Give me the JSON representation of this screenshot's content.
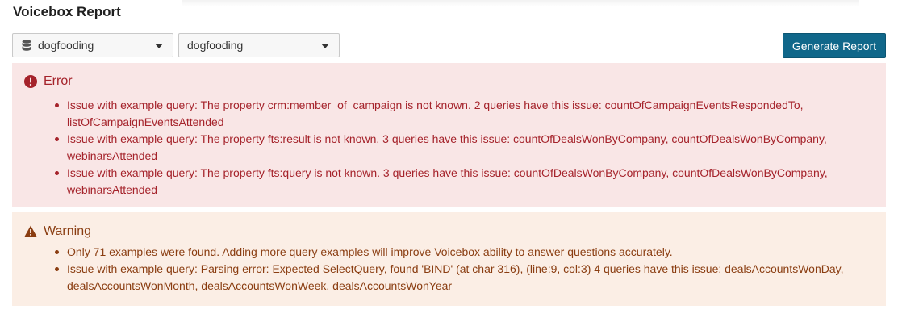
{
  "page": {
    "title": "Voicebox Report"
  },
  "toolbar": {
    "database_select": {
      "value": "dogfooding",
      "icon": "database-icon"
    },
    "second_select": {
      "value": "dogfooding"
    },
    "generate_label": "Generate Report"
  },
  "error": {
    "heading": "Error",
    "icon": "error-circle-icon",
    "color": "#a5232b",
    "background": "#f9e6e6",
    "items": [
      "Issue with example query: The property crm:member_of_campaign is not known. 2 queries have this issue: countOfCampaignEventsRespondedTo, listOfCampaignEventsAttended",
      "Issue with example query: The property fts:result is not known. 3 queries have this issue: countOfDealsWonByCompany, countOfDealsWonByCompany, webinarsAttended",
      "Issue with example query: The property fts:query is not known. 3 queries have this issue: countOfDealsWonByCompany, countOfDealsWonByCompany, webinarsAttended"
    ]
  },
  "warning": {
    "heading": "Warning",
    "icon": "warning-triangle-icon",
    "color": "#8a3d11",
    "background": "#fbeee5",
    "items": [
      "Only 71 examples were found. Adding more query examples will improve Voicebox ability to answer questions accurately.",
      "Issue with example query: Parsing error: Expected SelectQuery, found 'BIND' (at char 316), (line:9, col:3) 4 queries have this issue: dealsAccountsWonDay, dealsAccountsWonMonth, dealsAccountsWonWeek, dealsAccountsWonYear"
    ]
  },
  "colors": {
    "primary_button": "#10678a"
  }
}
